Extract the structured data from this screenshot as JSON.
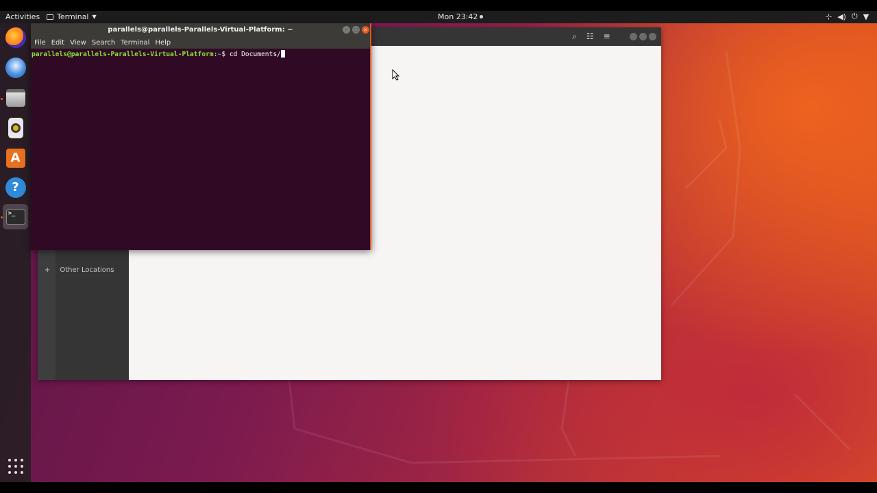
{
  "topbar": {
    "activities": "Activities",
    "app_name": "Terminal",
    "clock": "Mon 23:42"
  },
  "dock": {
    "items": [
      {
        "name": "Firefox",
        "icon": "firefox-icon"
      },
      {
        "name": "Thunderbird",
        "icon": "thunderbird-icon"
      },
      {
        "name": "Files",
        "icon": "files-icon"
      },
      {
        "name": "Rhythmbox",
        "icon": "rhythmbox-icon"
      },
      {
        "name": "Ubuntu Software",
        "icon": "software-icon",
        "glyph": "A"
      },
      {
        "name": "Help",
        "icon": "help-icon",
        "glyph": "?"
      },
      {
        "name": "Terminal",
        "icon": "terminal-icon",
        "glyph": ">_"
      }
    ]
  },
  "files": {
    "sidebar": {
      "other_locations": "Other Locations",
      "add_glyph": "+"
    }
  },
  "terminal": {
    "title": "parallels@parallels-Parallels-Virtual-Platform: ~",
    "menu": [
      "File",
      "Edit",
      "View",
      "Search",
      "Terminal",
      "Help"
    ],
    "prompt_user": "parallels@parallels-Parallels-Virtual-Platform",
    "prompt_sep": ":",
    "prompt_path": "~",
    "prompt_symbol": "$ ",
    "command": "cd Documents/"
  },
  "colors": {
    "terminal_bg": "#300a24",
    "accent": "#e95420",
    "prompt_green": "#8ae234",
    "prompt_blue": "#729fcf"
  }
}
